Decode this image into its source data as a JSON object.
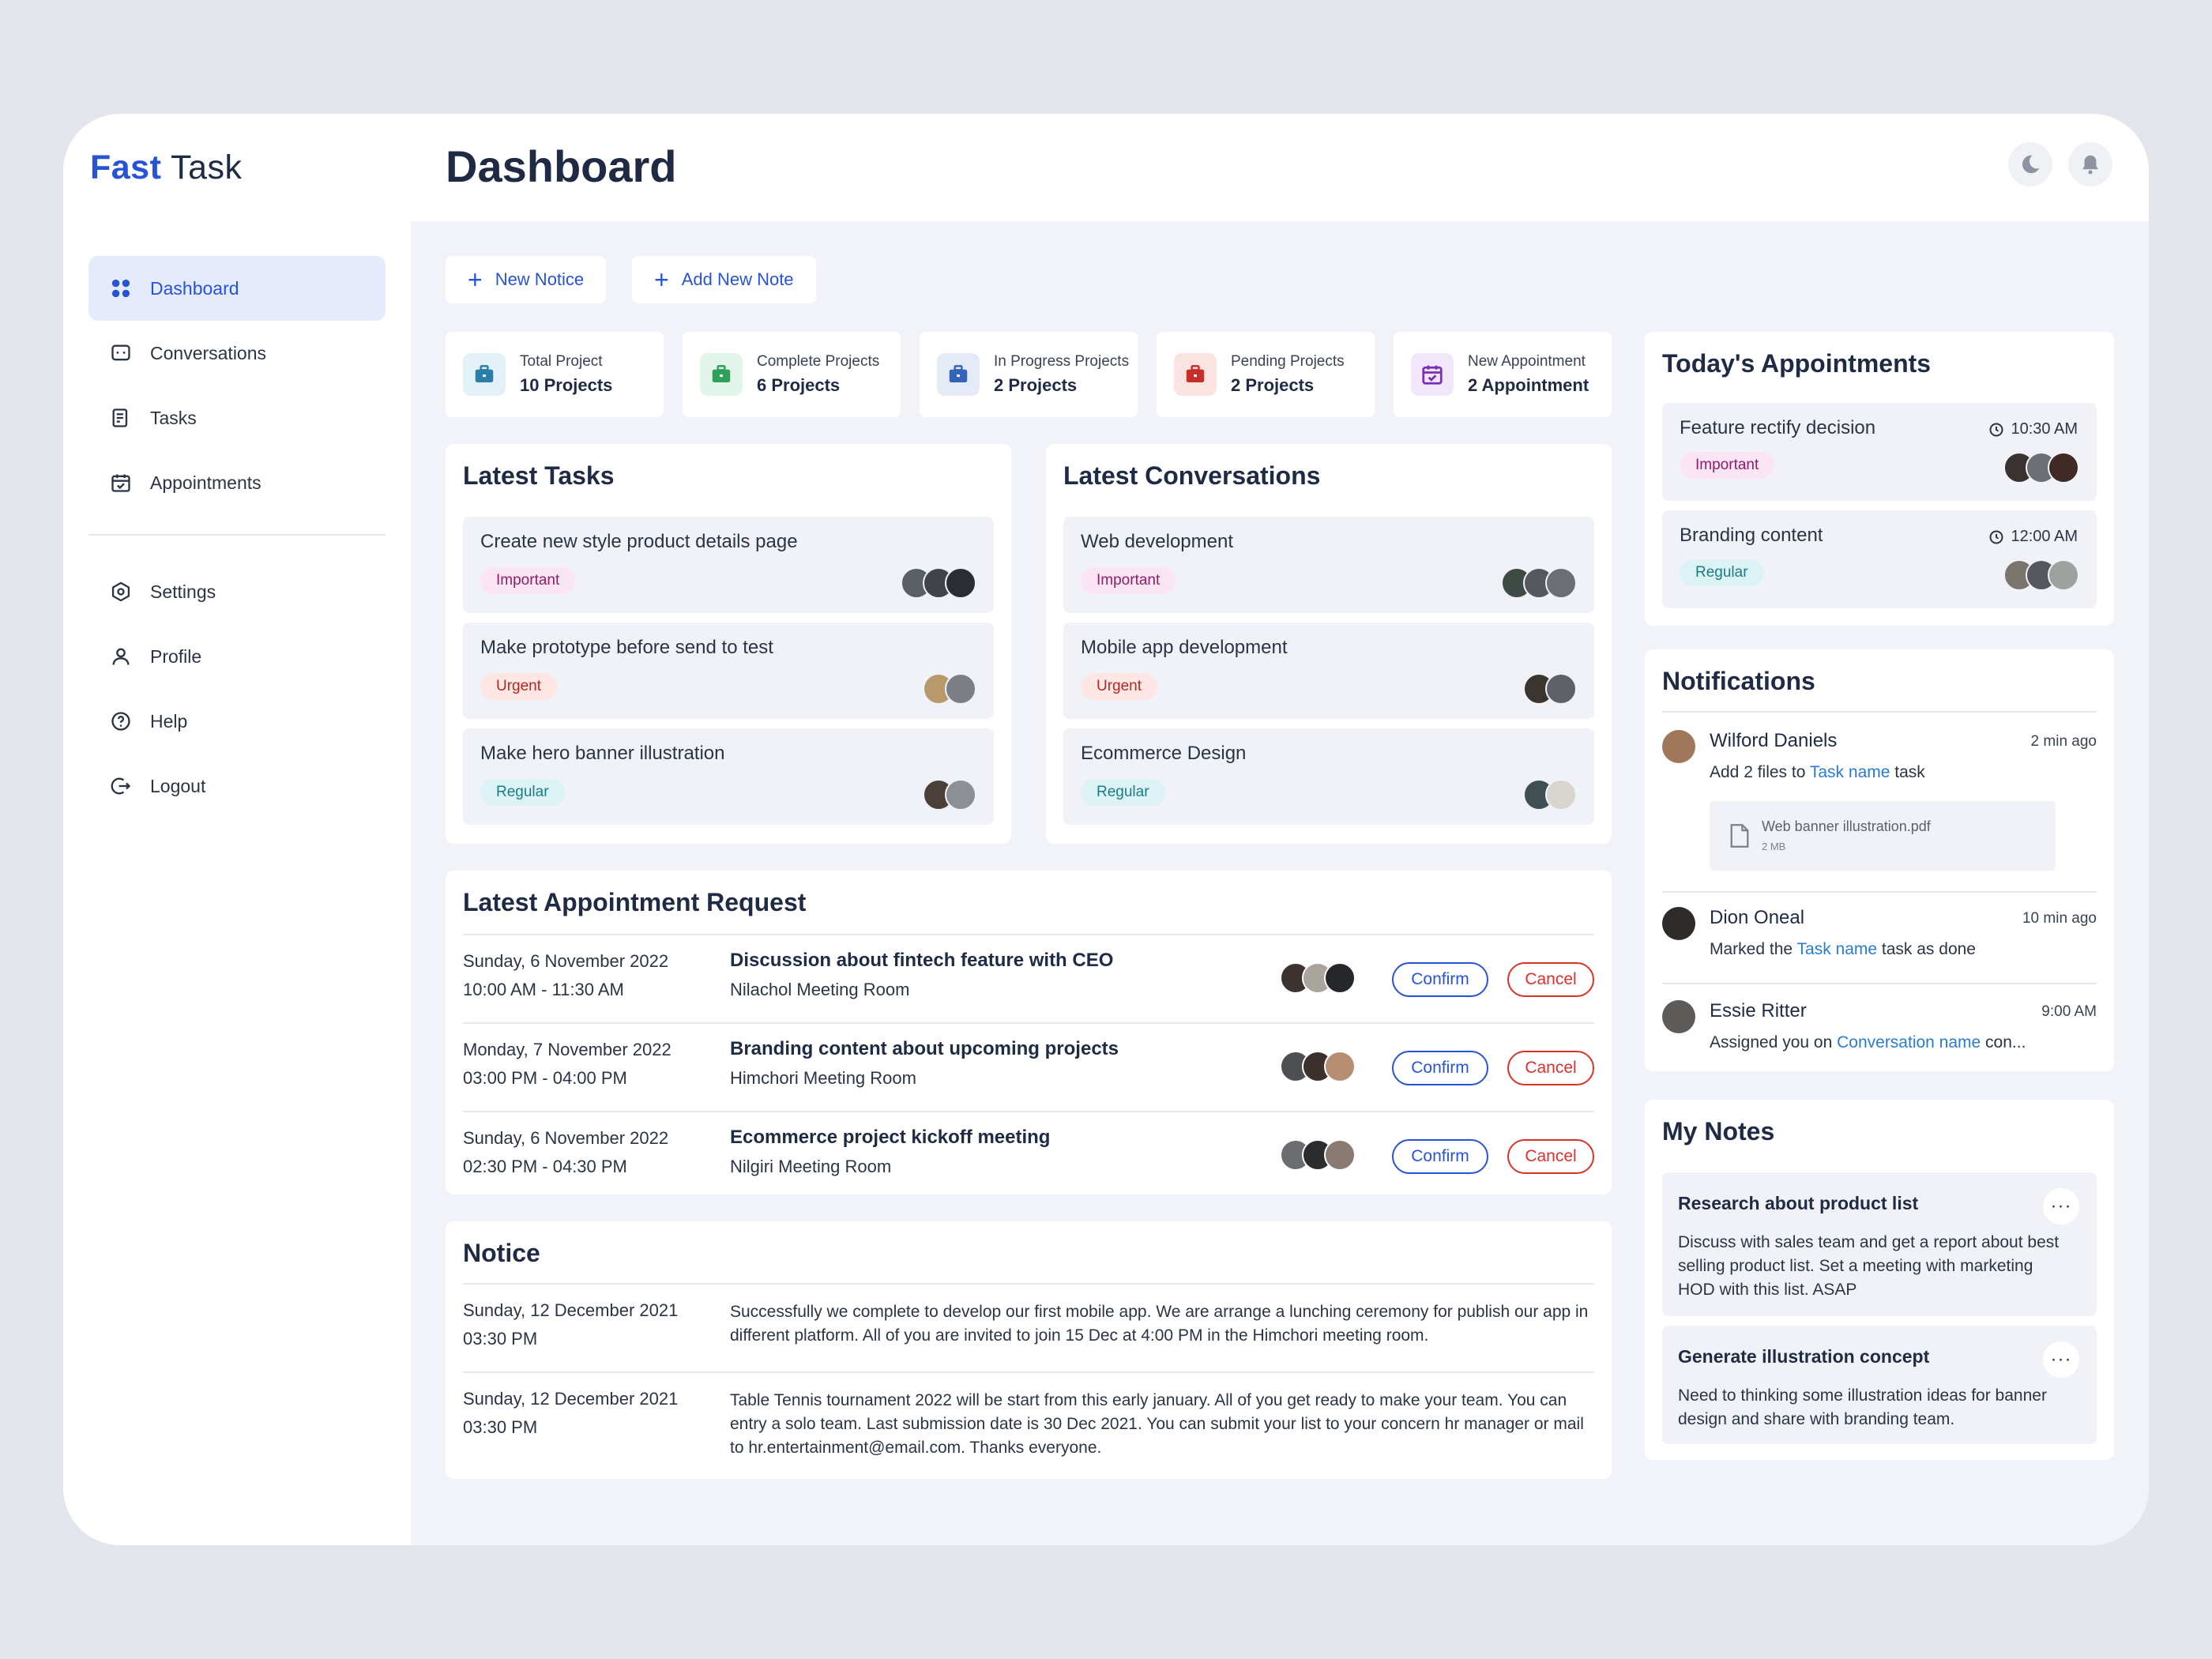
{
  "app": {
    "logo_bold": "Fast",
    "logo_rest": "Task",
    "page_title": "Dashboard"
  },
  "header_icons": [
    "moon-icon",
    "bell-icon"
  ],
  "sidebar": {
    "items": [
      {
        "label": "Dashboard",
        "icon": "grid-icon",
        "active": true
      },
      {
        "label": "Conversations",
        "icon": "chat-icon"
      },
      {
        "label": "Tasks",
        "icon": "tasks-icon"
      },
      {
        "label": "Appointments",
        "icon": "calendar-icon"
      }
    ],
    "secondary": [
      {
        "label": "Settings",
        "icon": "settings-icon"
      },
      {
        "label": "Profile",
        "icon": "user-icon"
      },
      {
        "label": "Help",
        "icon": "help-icon"
      },
      {
        "label": "Logout",
        "icon": "logout-icon"
      }
    ]
  },
  "actions": {
    "new_notice": "New Notice",
    "add_note": "Add New Note"
  },
  "stats": [
    {
      "label": "Total Project",
      "value": "10 Projects",
      "color": "#2b7ea8",
      "bg": "#e3f1f8"
    },
    {
      "label": "Complete Projects",
      "value": "6 Projects",
      "color": "#2ea05a",
      "bg": "#e2f5ea"
    },
    {
      "label": "In Progress Projects",
      "value": "2 Projects",
      "color": "#3563b8",
      "bg": "#e4ebf7"
    },
    {
      "label": "Pending Projects",
      "value": "2 Projects",
      "color": "#c62f2a",
      "bg": "#fbe3e2"
    },
    {
      "label": "New Appointment",
      "value": "2 Appointment",
      "color": "#7b2fb8",
      "bg": "#f1e6fa"
    }
  ],
  "latest_tasks": {
    "title": "Latest Tasks",
    "items": [
      {
        "title": "Create new style product details page",
        "tag": "Important"
      },
      {
        "title": "Make prototype before send to test",
        "tag": "Urgent"
      },
      {
        "title": "Make hero banner illustration",
        "tag": "Regular"
      }
    ]
  },
  "latest_conversations": {
    "title": "Latest Conversations",
    "items": [
      {
        "title": "Web development",
        "tag": "Important"
      },
      {
        "title": "Mobile app development",
        "tag": "Urgent"
      },
      {
        "title": "Ecommerce Design",
        "tag": "Regular"
      }
    ]
  },
  "appointment_requests": {
    "title": "Latest Appointment Request",
    "confirm": "Confirm",
    "cancel": "Cancel",
    "rows": [
      {
        "date": "Sunday, 6 November 2022",
        "time": "10:00 AM - 11:30 AM",
        "title": "Discussion about fintech feature with CEO",
        "room": "Nilachol Meeting Room"
      },
      {
        "date": "Monday, 7 November 2022",
        "time": "03:00 PM - 04:00 PM",
        "title": "Branding content about upcoming projects",
        "room": "Himchori Meeting Room"
      },
      {
        "date": "Sunday, 6 November 2022",
        "time": "02:30 PM - 04:30 PM",
        "title": "Ecommerce project kickoff meeting",
        "room": "Nilgiri Meeting Room"
      }
    ]
  },
  "notice": {
    "title": "Notice",
    "rows": [
      {
        "date": "Sunday, 12 December 2021",
        "time": "03:30 PM",
        "text": "Successfully we complete to develop our first mobile app. We are arrange a lunching ceremony for publish our app in different platform. All of you are invited to join 15 Dec at 4:00 PM in the Himchori meeting room."
      },
      {
        "date": "Sunday, 12 December 2021",
        "time": "03:30 PM",
        "text": "Table Tennis tournament 2022 will be start from this early january. All of you get ready to make your team. You can entry a solo team. Last submission date is 30 Dec 2021. You can submit your list to your concern hr manager or mail to hr.entertainment@email.com. Thanks everyone."
      }
    ]
  },
  "todays_appointments": {
    "title": "Today's Appointments",
    "items": [
      {
        "title": "Feature rectify decision",
        "time": "10:30 AM",
        "tag": "Important"
      },
      {
        "title": "Branding content",
        "time": "12:00 AM",
        "tag": "Regular"
      }
    ]
  },
  "notifications": {
    "title": "Notifications",
    "items": [
      {
        "name": "Wilford Daniels",
        "ago": "2 min ago",
        "pre": "Add 2 files to ",
        "link": "Task name",
        "post": " task",
        "file_name": "Web banner illustration.pdf",
        "file_size": "2 MB"
      },
      {
        "name": "Dion Oneal",
        "ago": "10 min ago",
        "pre": "Marked the ",
        "link": "Task name",
        "post": " task as done"
      },
      {
        "name": "Essie Ritter",
        "ago": "9:00 AM",
        "pre": "Assigned you on ",
        "link": "Conversation name",
        "post": " con..."
      }
    ]
  },
  "notes": {
    "title": "My Notes",
    "more": "···",
    "items": [
      {
        "title": "Research about product list",
        "body": "Discuss with sales team and get a report about best selling product list. Set a meeting with marketing HOD with this list. ASAP"
      },
      {
        "title": "Generate illustration concept",
        "body": "Need to thinking some illustration ideas for banner design and share with branding team."
      }
    ]
  }
}
